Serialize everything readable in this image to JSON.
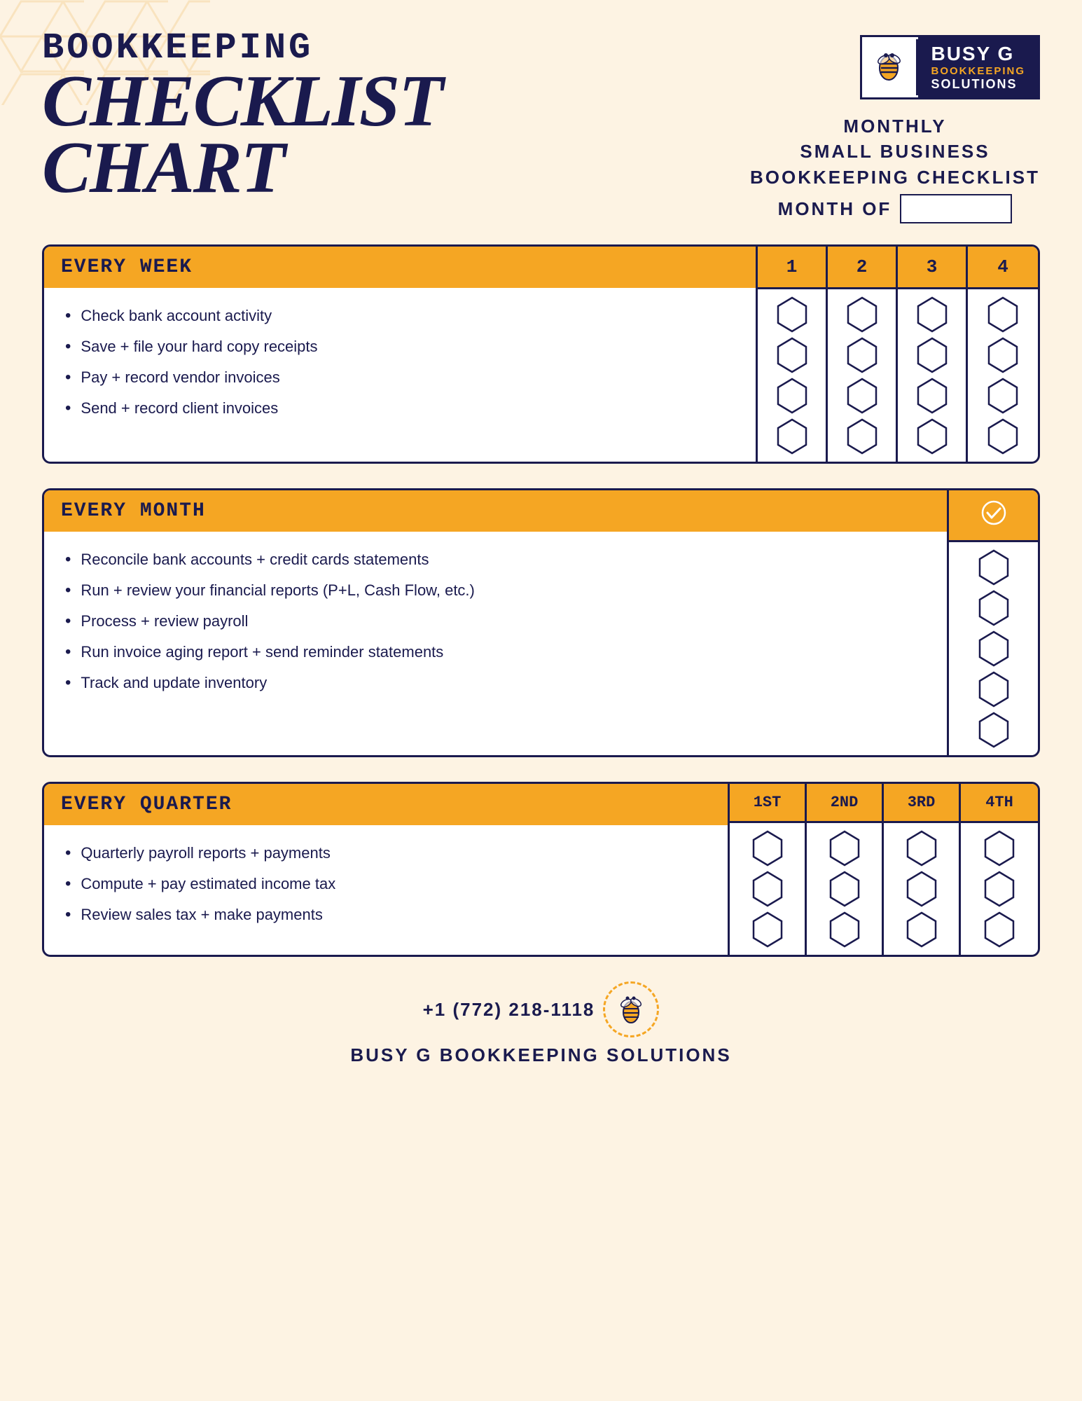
{
  "header": {
    "title_line1": "BOOKKEEPING",
    "title_line2": "CHECKLIST",
    "title_line3": "CHART",
    "monthly_line1": "MONTHLY",
    "monthly_line2": "SMALL BUSINESS",
    "monthly_line3": "BOOKKEEPING CHECKLIST",
    "month_of_label": "MONTH OF",
    "logo": {
      "busy_g": "BUSY G",
      "bookkeeping": "BOOKKEEPING",
      "solutions": "SOLUTIONS"
    }
  },
  "every_week": {
    "header": "EVERY WEEK",
    "items": [
      "Check bank account activity",
      "Save + file your hard copy receipts",
      "Pay + record vendor invoices",
      "Send + record client invoices"
    ],
    "cols": [
      "1",
      "2",
      "3",
      "4"
    ]
  },
  "every_month": {
    "header": "EVERY MONTH",
    "items": [
      "Reconcile bank accounts + credit cards statements",
      "Run + review your financial reports (P+L, Cash Flow, etc.)",
      "Process + review payroll",
      "Run invoice aging report + send reminder statements",
      "Track and update inventory"
    ],
    "col_check": "✓"
  },
  "every_quarter": {
    "header": "EVERY QUARTER",
    "items": [
      "Quarterly payroll reports + payments",
      "Compute + pay estimated income tax",
      "Review sales tax + make payments"
    ],
    "cols": [
      "1ST",
      "2ND",
      "3RD",
      "4TH"
    ]
  },
  "footer": {
    "phone": "+1 (772) 218-1118",
    "name": "BUSY G BOOKKEEPING SOLUTIONS"
  }
}
